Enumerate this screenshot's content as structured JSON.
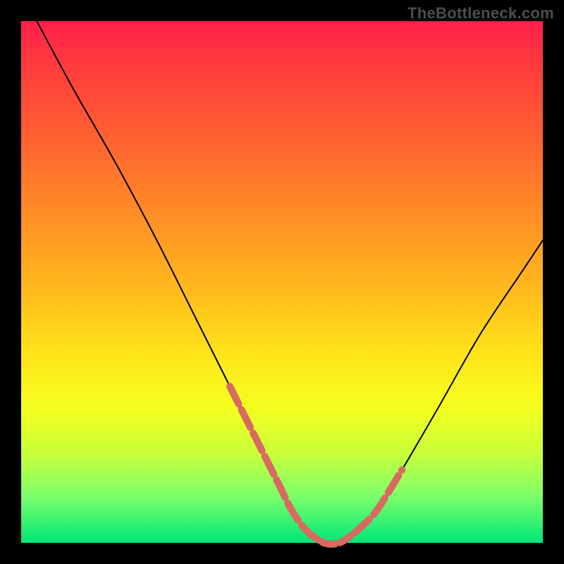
{
  "watermark": "TheBottleneck.com",
  "chart_data": {
    "type": "line",
    "title": "",
    "xlabel": "",
    "ylabel": "",
    "xlim": [
      0,
      100
    ],
    "ylim": [
      0,
      100
    ],
    "grid": false,
    "legend": false,
    "series": [
      {
        "name": "main-curve",
        "color": "#000000",
        "stroke_width": 2,
        "x": [
          3,
          10,
          18,
          26,
          34,
          40,
          45,
          49,
          52,
          55,
          58,
          61,
          64,
          68,
          73,
          80,
          88,
          96,
          100
        ],
        "y": [
          100,
          87,
          73,
          58,
          42,
          30,
          20,
          12,
          6,
          2,
          0,
          0,
          2,
          6,
          14,
          26,
          40,
          52,
          58
        ]
      },
      {
        "name": "highlight-left",
        "color": "#d86a62",
        "stroke_width": 10,
        "dash": [
          28,
          9
        ],
        "x": [
          40,
          45,
          49,
          52,
          55,
          58
        ],
        "y": [
          30,
          20,
          12,
          6,
          2,
          0
        ]
      },
      {
        "name": "highlight-bottom",
        "color": "#d86a62",
        "stroke_width": 10,
        "dash": [
          18,
          7
        ],
        "x": [
          55,
          58,
          61,
          64
        ],
        "y": [
          2,
          0,
          0,
          2
        ]
      },
      {
        "name": "highlight-right",
        "color": "#d86a62",
        "stroke_width": 10,
        "dash": [
          28,
          9
        ],
        "x": [
          64,
          68,
          73
        ],
        "y": [
          2,
          6,
          14
        ]
      }
    ]
  }
}
